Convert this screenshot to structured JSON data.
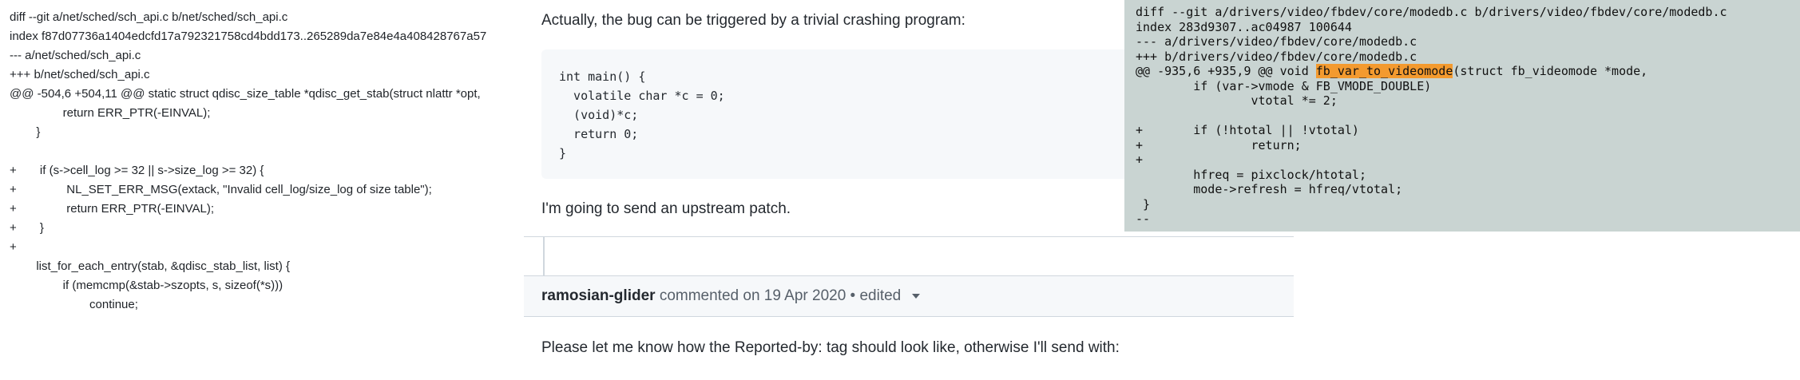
{
  "left_diff": {
    "lines": [
      "diff --git a/net/sched/sch_api.c b/net/sched/sch_api.c",
      "index f87d07736a1404edcfd17a792321758cd4bdd173..265289da7e84e4a408428767a57",
      "--- a/net/sched/sch_api.c",
      "+++ b/net/sched/sch_api.c",
      "@@ -504,6 +504,11 @@ static struct qdisc_size_table *qdisc_get_stab(struct nlattr *opt,",
      "                return ERR_PTR(-EINVAL);",
      "        }",
      "",
      "+       if (s->cell_log >= 32 || s->size_log >= 32) {",
      "+               NL_SET_ERR_MSG(extack, \"Invalid cell_log/size_log of size table\");",
      "+               return ERR_PTR(-EINVAL);",
      "+       }",
      "+",
      "        list_for_each_entry(stab, &qdisc_stab_list, list) {",
      "                if (memcmp(&stab->szopts, s, sizeof(*s)))",
      "                        continue;"
    ]
  },
  "comment": {
    "intro": "Actually, the bug can be triggered by a trivial crashing program:",
    "code_lines": [
      "int main() {",
      "  volatile char *c = 0;",
      "  (void)*c;",
      "  return 0;",
      "}"
    ],
    "outro": "I'm going to send an upstream patch."
  },
  "next_comment": {
    "author": "ramosian-glider",
    "meta": "commented on 19 Apr 2020",
    "edited": "• edited",
    "body": "Please let me know how the Reported-by: tag should look like, otherwise I'll send with:"
  },
  "right_diff": {
    "lines": [
      "diff --git a/drivers/video/fbdev/core/modedb.c b/drivers/video/fbdev/core/modedb.c",
      "index 283d9307..ac04987 100644",
      "--- a/drivers/video/fbdev/core/modedb.c",
      "+++ b/drivers/video/fbdev/core/modedb.c",
      "@@ -935,6 +935,9 @@ void ",
      "        if (var->vmode & FB_VMODE_DOUBLE)",
      "                vtotal *= 2;",
      "",
      "+       if (!htotal || !vtotal)",
      "+               return;",
      "+",
      "        hfreq = pixclock/htotal;",
      "        mode->refresh = hfreq/vtotal;",
      " }",
      "--"
    ],
    "highlight_word": "fb_var_to_videomode",
    "after_highlight": "(struct fb_videomode *mode,"
  }
}
